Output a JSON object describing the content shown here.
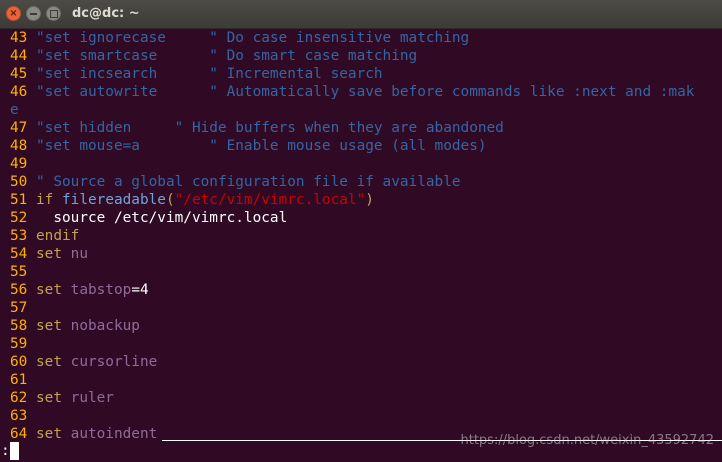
{
  "window": {
    "title": "dc@dc: ~",
    "close_glyph": "×"
  },
  "lines": [
    {
      "n": "43",
      "text": "\"set ignorecase     \" Do case insensitive matching"
    },
    {
      "n": "44",
      "text": "\"set smartcase      \" Do smart case matching"
    },
    {
      "n": "45",
      "text": "\"set incsearch      \" Incremental search"
    },
    {
      "n": "46",
      "text": "\"set autowrite      \" Automatically save before commands like :next and :mak"
    },
    {
      "n": "",
      "text": "e"
    },
    {
      "n": "47",
      "text": "\"set hidden     \" Hide buffers when they are abandoned"
    },
    {
      "n": "48",
      "text": "\"set mouse=a        \" Enable mouse usage (all modes)"
    },
    {
      "n": "49",
      "text": ""
    },
    {
      "n": "50",
      "text": "\" Source a global configuration file if available"
    },
    {
      "n": "51",
      "kw": "if ",
      "fn": "filereadable",
      "p1": "(",
      "str": "\"/etc/vim/vimrc.local\"",
      "p2": ")"
    },
    {
      "n": "52",
      "text": "  source /etc/vim/vimrc.local"
    },
    {
      "n": "53",
      "kw": "endif"
    },
    {
      "n": "54",
      "kw": "set ",
      "id": "nu"
    },
    {
      "n": "55",
      "text": ""
    },
    {
      "n": "56",
      "kw": "set ",
      "id": "tabstop",
      "rest": "=4"
    },
    {
      "n": "57",
      "text": ""
    },
    {
      "n": "58",
      "kw": "set ",
      "id": "nobackup"
    },
    {
      "n": "59",
      "text": ""
    },
    {
      "n": "60",
      "kw": "set ",
      "id": "cursorline"
    },
    {
      "n": "61",
      "text": ""
    },
    {
      "n": "62",
      "kw": "set ",
      "id": "ruler"
    },
    {
      "n": "63",
      "text": ""
    },
    {
      "n": "64",
      "kw": "set ",
      "id": "autoindent"
    }
  ],
  "command_line": ":",
  "watermark": "https://blog.csdn.net/weixin_43592742",
  "colors": {
    "background": "#300a24",
    "line_number": "#ffb000",
    "comment": "#3465a4",
    "keyword": "#c3a34c",
    "function": "#6da4db",
    "string": "#cc0000",
    "option": "#8d6c9a"
  }
}
